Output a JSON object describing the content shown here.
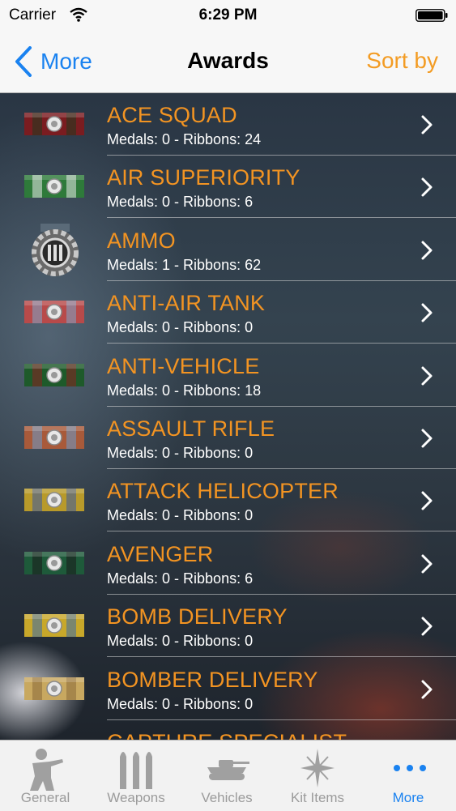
{
  "status_bar": {
    "carrier": "Carrier",
    "time": "6:29 PM"
  },
  "nav": {
    "back_label": "More",
    "title": "Awards",
    "sort_label": "Sort by"
  },
  "awards": [
    {
      "name": "ACE SQUAD",
      "stats": "Medals: 0 - Ribbons: 24",
      "ribbon_colors": [
        "#7a1c20",
        "#1f3a1f",
        "#7a1c20"
      ]
    },
    {
      "name": "AIR SUPERIORITY",
      "stats": "Medals: 0 - Ribbons: 6",
      "ribbon_colors": [
        "#2e7a3a",
        "#e8e8e8",
        "#2e7a3a"
      ]
    },
    {
      "name": "AMMO",
      "stats": "Medals: 1 - Ribbons: 62",
      "ribbon_colors": [
        "#5a6a78",
        "#c8c8c8",
        "#5a6a78"
      ]
    },
    {
      "name": "ANTI-AIR TANK",
      "stats": "Medals: 0 - Ribbons: 0",
      "ribbon_colors": [
        "#b84a4a",
        "#7aa6c8",
        "#b84a4a"
      ]
    },
    {
      "name": "ANTI-VEHICLE",
      "stats": "Medals: 0 - Ribbons: 18",
      "ribbon_colors": [
        "#1e5a2a",
        "#8a2020",
        "#1e5a2a"
      ]
    },
    {
      "name": "ASSAULT RIFLE",
      "stats": "Medals: 0 - Ribbons: 0",
      "ribbon_colors": [
        "#a85a3a",
        "#6a9ac8",
        "#a85a3a"
      ]
    },
    {
      "name": "ATTACK HELICOPTER",
      "stats": "Medals: 0 - Ribbons: 0",
      "ribbon_colors": [
        "#b89a2a",
        "#3a5aa0",
        "#b89a2a"
      ]
    },
    {
      "name": "AVENGER",
      "stats": "Medals: 0 - Ribbons: 6",
      "ribbon_colors": [
        "#1e5a3a",
        "#1a1a1a",
        "#1e5a3a"
      ]
    },
    {
      "name": "BOMB DELIVERY",
      "stats": "Medals: 0 - Ribbons: 0",
      "ribbon_colors": [
        "#c8a82a",
        "#3a6aa8",
        "#c8a82a"
      ]
    },
    {
      "name": "BOMBER DELIVERY",
      "stats": "Medals: 0 - Ribbons: 0",
      "ribbon_colors": [
        "#c8a860",
        "#8a6a3a",
        "#c8a860"
      ]
    },
    {
      "name": "CAPTURE SPECIALIST",
      "stats": "",
      "ribbon_colors": [
        "#4a6a8a",
        "#c8c8c8",
        "#4a6a8a"
      ]
    }
  ],
  "tabs": [
    {
      "label": "General",
      "icon": "soldier-icon",
      "active": false
    },
    {
      "label": "Weapons",
      "icon": "bullets-icon",
      "active": false
    },
    {
      "label": "Vehicles",
      "icon": "tank-icon",
      "active": false
    },
    {
      "label": "Kit Items",
      "icon": "kit-star-icon",
      "active": false
    },
    {
      "label": "More",
      "icon": "more-dots-icon",
      "active": true
    }
  ],
  "colors": {
    "accent_blue": "#1a82f0",
    "award_orange": "#f39422",
    "sort_orange": "#f39c24"
  }
}
